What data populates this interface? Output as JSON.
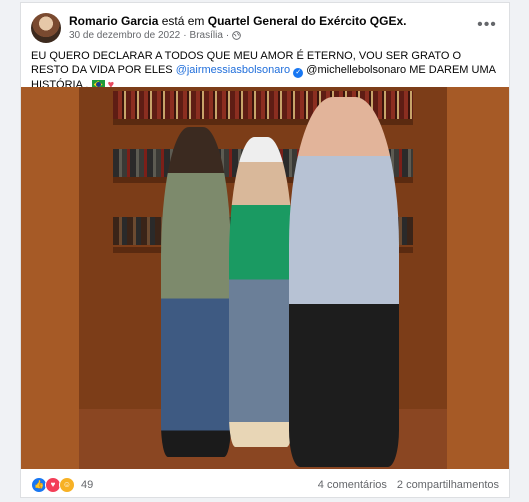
{
  "post": {
    "author": "Romario Garcia",
    "connector": "está em",
    "place": "Quartel General do Exército QGEx.",
    "date": "30 de dezembro de 2022",
    "separator": "·",
    "location": "Brasília",
    "separator2": "·",
    "more_label": "•••",
    "text_part1": "EU QUERO DECLARAR A TODOS  QUE MEU AMOR É ETERNO, VOU SER GRATO O RESTO DA VIDA POR ELES ",
    "mention1": "@jairmessiasbolsonaro",
    "text_part2": " @michellebolsonaro ME DAREM UMA HISTÓRIA  . ",
    "flag_icon": "brazil-flag-icon",
    "heart_icon": "smiling-face-with-hearts-icon"
  },
  "footer": {
    "reaction_count": "49",
    "comments": "4 comentários",
    "shares": "2 compartilhamentos",
    "reaction_icons": [
      "like-icon",
      "love-icon",
      "haha-icon"
    ]
  },
  "colors": {
    "link": "#216fdb",
    "meta": "#65676b",
    "photo_bg": "#a65a26",
    "like": "#1877f2",
    "love": "#f33e58",
    "haha": "#f7b125"
  }
}
